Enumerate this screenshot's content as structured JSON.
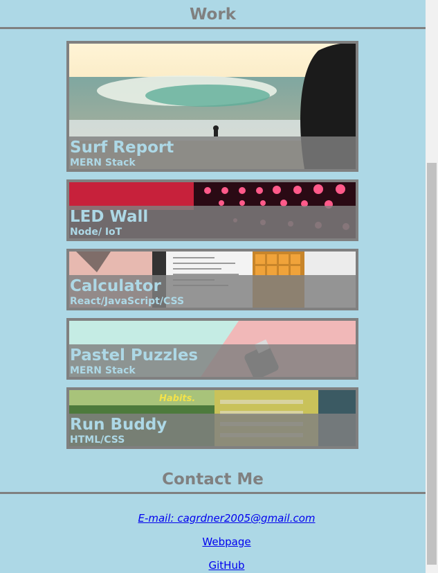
{
  "work": {
    "heading": "Work",
    "projects": [
      {
        "title": "Surf Report",
        "stack": "MERN Stack",
        "image": "surf-wave-photo"
      },
      {
        "title": "LED Wall",
        "stack": "Node/ IoT",
        "image": "red-led-lights-photo"
      },
      {
        "title": "Calculator",
        "stack": "React/JavaScript/CSS",
        "image": "calculator-app-screenshot"
      },
      {
        "title": "Pastel Puzzles",
        "stack": "MERN Stack",
        "image": "pastel-usb-photo"
      },
      {
        "title": "Run Buddy",
        "stack": "HTML/CSS",
        "image": "run-buddy-site-screenshot"
      }
    ]
  },
  "contact": {
    "heading": "Contact Me",
    "email": "E-mail: cagrdner2005@gmail.com",
    "webpage": "Webpage",
    "github": "GitHub"
  },
  "colors": {
    "background": "#add8e6",
    "heading_gray": "#808080",
    "link_blue": "#0000ee"
  }
}
